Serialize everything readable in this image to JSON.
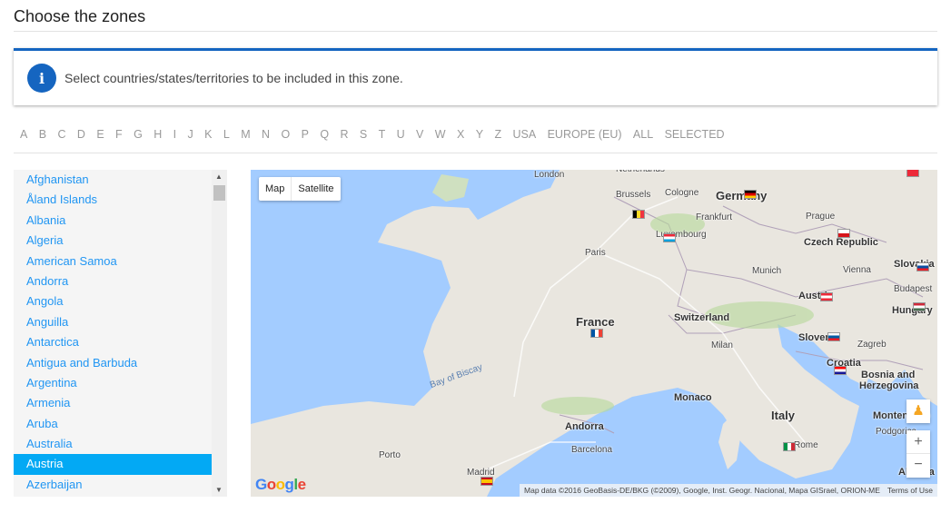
{
  "title": "Choose the zones",
  "info": {
    "icon": "info-icon",
    "text": "Select countries/states/territories to be included in this zone.",
    "color": "#1565c0"
  },
  "filters": [
    "A",
    "B",
    "C",
    "D",
    "E",
    "F",
    "G",
    "H",
    "I",
    "J",
    "K",
    "L",
    "M",
    "N",
    "O",
    "P",
    "Q",
    "R",
    "S",
    "T",
    "U",
    "V",
    "W",
    "X",
    "Y",
    "Z",
    "USA",
    "EUROPE (EU)",
    "ALL",
    "SELECTED"
  ],
  "countries": [
    "Afghanistan",
    "Åland Islands",
    "Albania",
    "Algeria",
    "American Samoa",
    "Andorra",
    "Angola",
    "Anguilla",
    "Antarctica",
    "Antigua and Barbuda",
    "Argentina",
    "Armenia",
    "Aruba",
    "Australia",
    "Austria",
    "Azerbaijan"
  ],
  "selected_country": "Austria",
  "selected_color": "#03a9f4",
  "map": {
    "type_buttons": [
      "Map",
      "Satellite"
    ],
    "zoom_in": "+",
    "zoom_out": "−",
    "logo": "Google",
    "attribution": "Map data ©2016 GeoBasis-DE/BKG (©2009), Google, Inst. Geogr. Nacional, Mapa GISrael, ORION-ME",
    "terms": "Terms of Use",
    "labels": [
      {
        "t": "Netherlands",
        "c": ""
      },
      {
        "t": "London",
        "c": ""
      },
      {
        "t": "Brussels",
        "c": ""
      },
      {
        "t": "Cologne",
        "c": ""
      },
      {
        "t": "Germany",
        "c": "b"
      },
      {
        "t": "Frankfurt",
        "c": ""
      },
      {
        "t": "Prague",
        "c": ""
      },
      {
        "t": "Luxembourg",
        "c": ""
      },
      {
        "t": "Czech Republic",
        "c": "m"
      },
      {
        "t": "Paris",
        "c": ""
      },
      {
        "t": "Munich",
        "c": ""
      },
      {
        "t": "Vienna",
        "c": ""
      },
      {
        "t": "Slovakia",
        "c": "m"
      },
      {
        "t": "Budapest",
        "c": ""
      },
      {
        "t": "Austria",
        "c": "m"
      },
      {
        "t": "Hungary",
        "c": "m"
      },
      {
        "t": "France",
        "c": "b"
      },
      {
        "t": "Switzerland",
        "c": "m"
      },
      {
        "t": "Milan",
        "c": ""
      },
      {
        "t": "Slovenia",
        "c": "m"
      },
      {
        "t": "Zagreb",
        "c": ""
      },
      {
        "t": "Croatia",
        "c": "m"
      },
      {
        "t": "Bosnia and",
        "c": "m"
      },
      {
        "t": "Herzegovina",
        "c": "m"
      },
      {
        "t": "Bay of Biscay",
        "c": ""
      },
      {
        "t": "Monaco",
        "c": "m"
      },
      {
        "t": "Italy",
        "c": "b"
      },
      {
        "t": "Montenegro",
        "c": "m"
      },
      {
        "t": "Podgorica",
        "c": ""
      },
      {
        "t": "Andorra",
        "c": "m"
      },
      {
        "t": "Barcelona",
        "c": ""
      },
      {
        "t": "Porto",
        "c": ""
      },
      {
        "t": "Rome",
        "c": ""
      },
      {
        "t": "Madrid",
        "c": ""
      },
      {
        "t": "Albania",
        "c": "m"
      }
    ]
  }
}
